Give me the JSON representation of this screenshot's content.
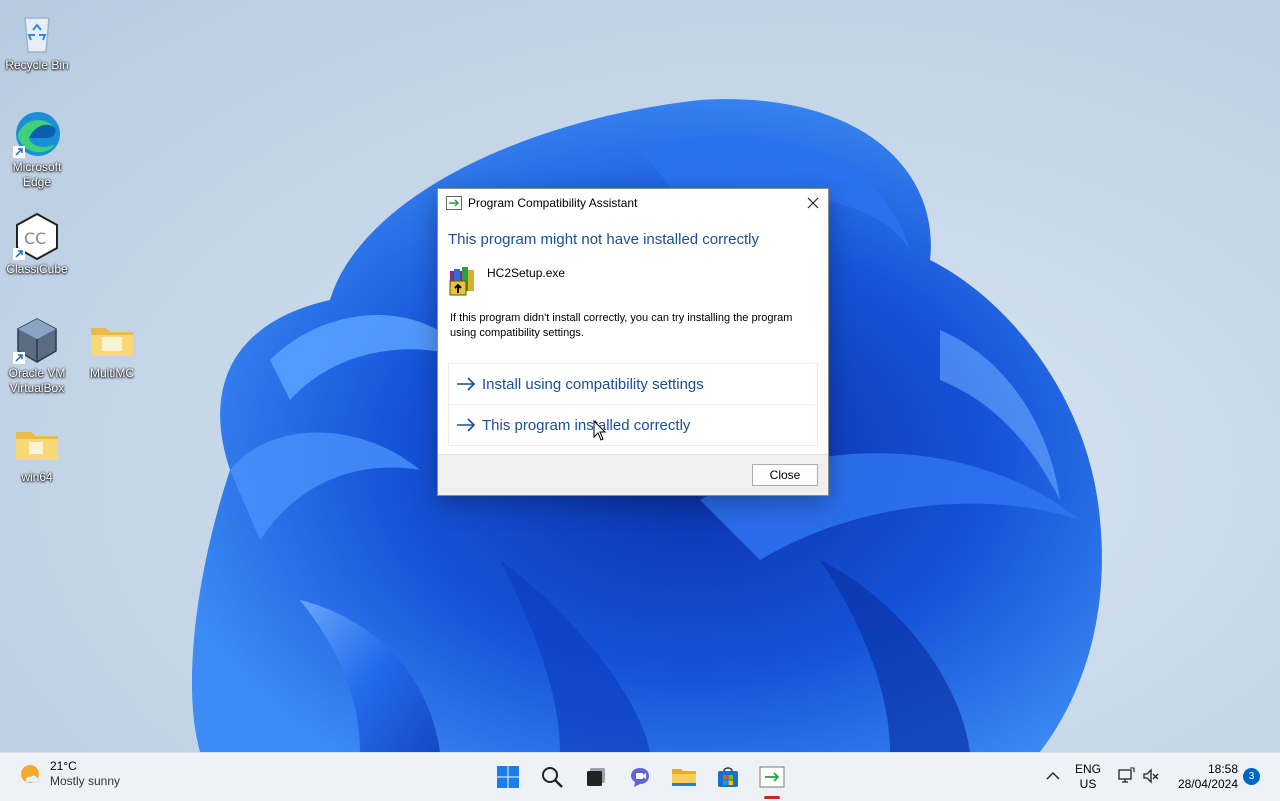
{
  "desktop": {
    "icons": [
      {
        "label": "Recycle Bin"
      },
      {
        "label": "Microsoft Edge"
      },
      {
        "label": "ClassiCube"
      },
      {
        "label": "Oracle VM VirtualBox"
      },
      {
        "label": "MultiMC"
      },
      {
        "label": "win64"
      }
    ]
  },
  "dialog": {
    "title": "Program Compatibility Assistant",
    "heading": "This program might not have installed correctly",
    "program_name": "HC2Setup.exe",
    "description": "If this program didn't install correctly, you can try installing the program using compatibility settings.",
    "options": [
      {
        "label": "Install using compatibility settings"
      },
      {
        "label": "This program installed correctly"
      }
    ],
    "close_button": "Close"
  },
  "taskbar": {
    "weather": {
      "temp": "21°C",
      "condition": "Mostly sunny"
    },
    "pinned": [
      "start-icon",
      "search-icon",
      "task-view-icon",
      "chat-icon",
      "file-explorer-icon",
      "store-icon",
      "compatibility-assistant-icon"
    ],
    "language": {
      "line1": "ENG",
      "line2": "US"
    },
    "clock": {
      "time": "18:58",
      "date": "28/04/2024"
    },
    "notification_count": "3"
  },
  "colors": {
    "accent": "#1a4e96",
    "wallpaper_blue": "#1d5ce6"
  }
}
